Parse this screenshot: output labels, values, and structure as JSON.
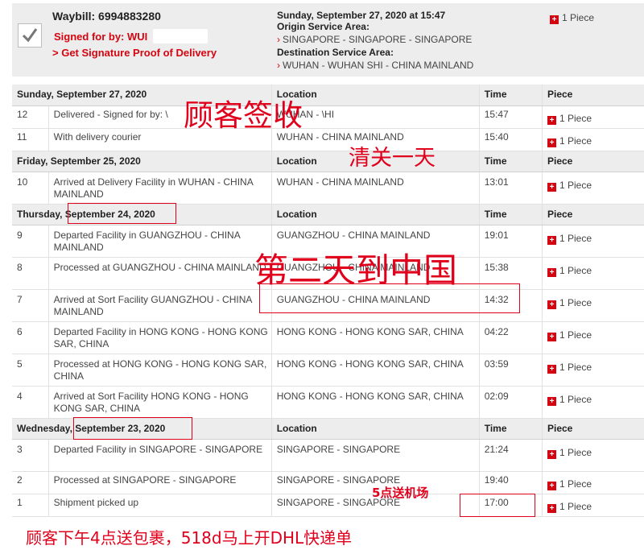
{
  "header": {
    "waybill": "Waybill: 6994883280",
    "signed_for": "Signed for by: WUI",
    "proof_link": "> Get Signature Proof of Delivery",
    "date_time": "Sunday, September 27, 2020 at 15:47",
    "origin_label": "Origin Service Area:",
    "origin_value": "SINGAPORE - SINGAPORE - SINGAPORE",
    "destination_label": "Destination Service Area:",
    "destination_value": "WUHAN - WUHAN SHI - CHINA MAINLAND",
    "piece": "1 Piece"
  },
  "columns": {
    "location": "Location",
    "time": "Time",
    "piece": "Piece"
  },
  "days": [
    {
      "date": "Sunday, September 27, 2020",
      "events": [
        {
          "n": "12",
          "desc": "Delivered - Signed for by: \\",
          "loc": "WUHAN - \\HI",
          "time": "15:47",
          "piece": "1 Piece"
        },
        {
          "n": "11",
          "desc": "With delivery courier",
          "loc": "WUHAN - CHINA MAINLAND",
          "time": "15:40",
          "piece": "1 Piece"
        }
      ]
    },
    {
      "date": "Friday, September 25, 2020",
      "events": [
        {
          "n": "10",
          "desc": "Arrived at Delivery Facility in WUHAN - CHINA MAINLAND",
          "loc": "WUHAN - CHINA MAINLAND",
          "time": "13:01",
          "piece": "1 Piece"
        }
      ]
    },
    {
      "date": "Thursday, September 24, 2020",
      "events": [
        {
          "n": "9",
          "desc": "Departed Facility in GUANGZHOU - CHINA MAINLAND",
          "loc": "GUANGZHOU - CHINA MAINLAND",
          "time": "19:01",
          "piece": "1 Piece"
        },
        {
          "n": "8",
          "desc": "Processed at GUANGZHOU - CHINA MAINLAND",
          "loc": "GUANGZHOU - CHINA MAINLAND",
          "time": "15:38",
          "piece": "1 Piece"
        },
        {
          "n": "7",
          "desc": "Arrived at Sort Facility GUANGZHOU - CHINA MAINLAND",
          "loc": "GUANGZHOU - CHINA MAINLAND",
          "time": "14:32",
          "piece": "1 Piece"
        },
        {
          "n": "6",
          "desc": "Departed Facility in HONG KONG - HONG KONG SAR, CHINA",
          "loc": "HONG KONG - HONG KONG SAR, CHINA",
          "time": "04:22",
          "piece": "1 Piece"
        },
        {
          "n": "5",
          "desc": "Processed at HONG KONG - HONG KONG SAR, CHINA",
          "loc": "HONG KONG - HONG KONG SAR, CHINA",
          "time": "03:59",
          "piece": "1 Piece"
        },
        {
          "n": "4",
          "desc": "Arrived at Sort Facility HONG KONG - HONG KONG SAR, CHINA",
          "loc": "HONG KONG - HONG KONG SAR, CHINA",
          "time": "02:09",
          "piece": "1 Piece"
        }
      ]
    },
    {
      "date": "Wednesday, September 23, 2020",
      "events": [
        {
          "n": "3",
          "desc": "Departed Facility in SINGAPORE - SINGAPORE",
          "loc": "SINGAPORE - SINGAPORE",
          "time": "21:24",
          "piece": "1 Piece"
        },
        {
          "n": "2",
          "desc": "Processed at SINGAPORE - SINGAPORE",
          "loc": "SINGAPORE - SINGAPORE",
          "time": "19:40",
          "piece": "1 Piece"
        },
        {
          "n": "1",
          "desc": "Shipment picked up",
          "loc": "SINGAPORE - SINGAPORE",
          "time": "17:00",
          "piece": "1 Piece"
        }
      ]
    }
  ],
  "annotations": {
    "customer_signed": "顾客签收",
    "one_day_clearance": "清关一天",
    "second_day_china": "第二天到中国",
    "five_pm_airport": "5点送机场",
    "bottom_note": "顾客下午4点送包裹，518d马上开DHL快递单"
  }
}
